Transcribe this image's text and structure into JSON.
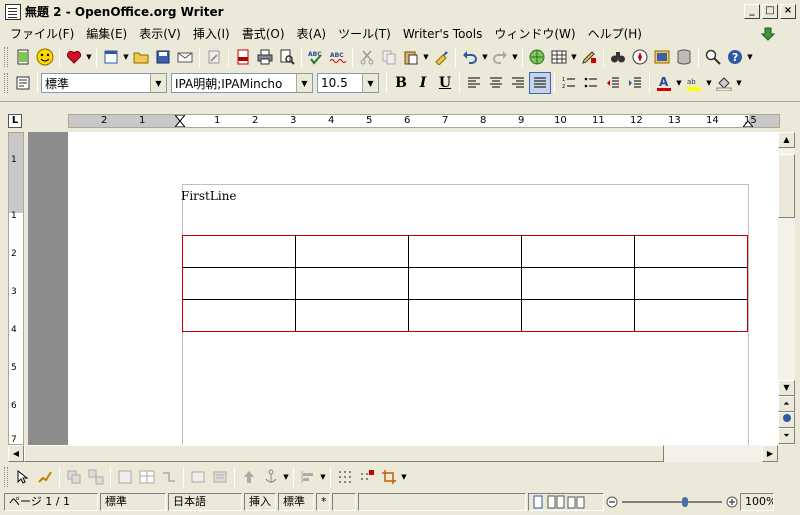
{
  "window": {
    "title": "無題 2 - OpenOffice.org Writer",
    "controls": [
      "_",
      "□",
      "×"
    ]
  },
  "menubar": {
    "items": [
      "ファイル(F)",
      "編集(E)",
      "表示(V)",
      "挿入(I)",
      "書式(O)",
      "表(A)",
      "ツール(T)",
      "Writer's Tools",
      "ウィンドウ(W)",
      "ヘルプ(H)"
    ]
  },
  "format_toolbar": {
    "style_value": "標準",
    "font_value": "IPA明朝;IPAMincho",
    "size_value": "10.5",
    "bold": "B",
    "italic": "I",
    "underline": "U"
  },
  "ruler": {
    "numbers": [
      "2",
      "1",
      "1",
      "2",
      "3",
      "4",
      "5",
      "6",
      "7",
      "8",
      "9",
      "10",
      "11",
      "12",
      "13",
      "14",
      "15"
    ],
    "vertical_numbers": [
      "1",
      "1",
      "2",
      "3",
      "4",
      "5",
      "6",
      "7"
    ]
  },
  "document": {
    "first_line": "FirstLine",
    "table": {
      "rows": 3,
      "cols": 5
    }
  },
  "statusbar": {
    "page": "ページ 1 / 1",
    "style": "標準",
    "language": "日本語",
    "insert_mode": "挿入",
    "selection_mode": "標準",
    "modified": "*",
    "zoom": "100%"
  },
  "colors": {
    "window_bg": "#ece9d8",
    "table_border_outer": "#cc0000",
    "doc_bg": "#808080"
  }
}
